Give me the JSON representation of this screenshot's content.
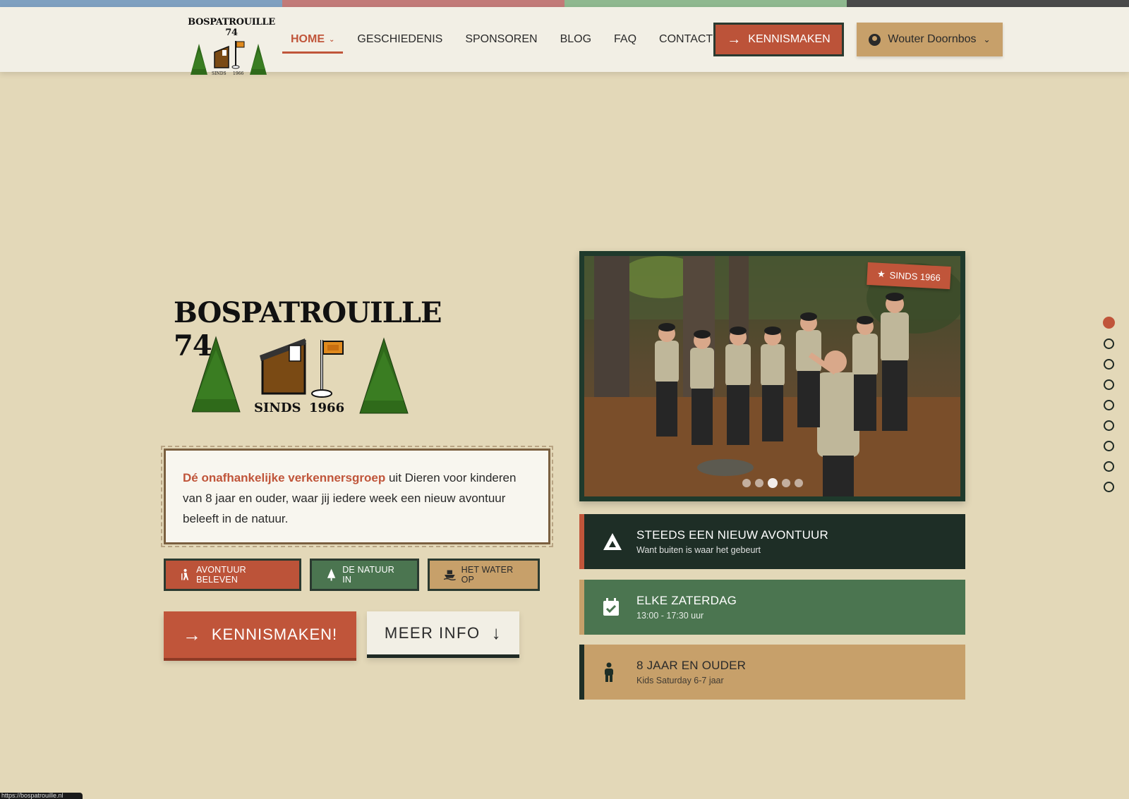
{
  "colors": {
    "stripe": [
      "#7fa0c0",
      "#c27a78",
      "#8fb88f",
      "#4a4a4a"
    ],
    "accent": "#c0553a",
    "dark_green": "#1f3a2c",
    "mid_green": "#4b7550",
    "tan": "#c7a06a",
    "background": "#e3d8b8"
  },
  "header": {
    "logo_title": "BOSPATROUILLE 74",
    "logo_sinds": "SINDS",
    "logo_year": "1966",
    "nav": [
      {
        "label": "HOME",
        "active": true
      },
      {
        "label": "GESCHIEDENIS"
      },
      {
        "label": "SPONSOREN"
      },
      {
        "label": "BLOG"
      },
      {
        "label": "FAQ"
      },
      {
        "label": "CONTACT"
      }
    ],
    "cta_label": "KENNISMAKEN",
    "user_name": "Wouter Doornbos"
  },
  "hero": {
    "title": "BOSPATROUILLE 74",
    "sinds": "SINDS",
    "year": "1966",
    "intro_highlight": "Dé onafhankelijke verkennersgroep",
    "intro_rest": " uit Dieren voor kinderen van 8 jaar en ouder, waar jij iedere week een nieuw avontuur beleeft in de natuur.",
    "tags": [
      {
        "label": "AVONTUUR BELEVEN",
        "icon": "hiker-icon",
        "color": "#bc5339"
      },
      {
        "label": "DE NATUUR IN",
        "icon": "tree-icon",
        "color": "#4b7550"
      },
      {
        "label": "HET WATER OP",
        "icon": "boat-icon",
        "color": "#c7a06a"
      }
    ],
    "cta_primary": "KENNISMAKEN!",
    "cta_secondary": "MEER INFO"
  },
  "carousel": {
    "badge": "SINDS 1966",
    "slides_count": 5,
    "active_slide": 2
  },
  "info_cards": [
    {
      "title": "STEEDS EEN NIEUW AVONTUUR",
      "subtitle": "Want buiten is waar het gebeurt",
      "icon": "mountain-icon",
      "bg": "#1e2e26",
      "border": "#c0553a"
    },
    {
      "title": "ELKE ZATERDAG",
      "subtitle": "13:00 - 17:30 uur",
      "icon": "calendar-check-icon",
      "bg": "#4b7550",
      "border": "#c7a06a"
    },
    {
      "title": "8 JAAR EN OUDER",
      "subtitle": "Kids Saturday 6-7 jaar",
      "icon": "child-icon",
      "bg": "#c7a06a",
      "border": "#1e2e26",
      "dark_text": true
    }
  ],
  "section_nav": {
    "count": 9,
    "active": 0
  },
  "status_url": "https://bospatrouille.nl"
}
